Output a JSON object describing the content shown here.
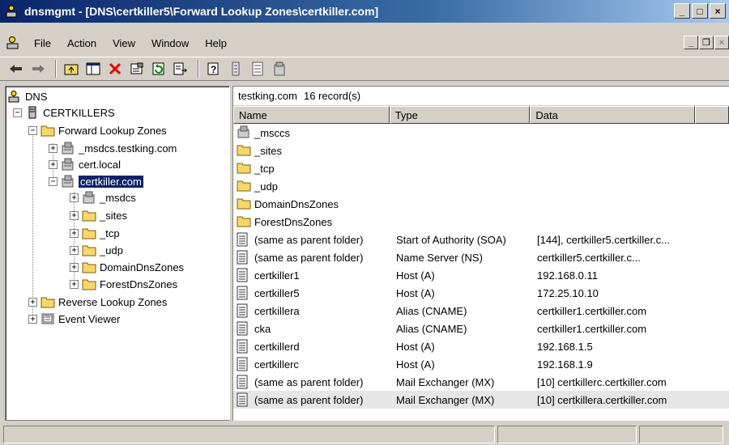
{
  "window": {
    "title": "dnsmgmt - [DNS\\certkiller5\\Forward Lookup Zones\\certkiller.com]",
    "min_label": "_",
    "max_label": "□",
    "close_label": "×"
  },
  "menu": {
    "items": [
      {
        "label": "File"
      },
      {
        "label": "Action"
      },
      {
        "label": "View"
      },
      {
        "label": "Window"
      },
      {
        "label": "Help"
      }
    ],
    "doc_min": "_",
    "doc_restore": "❐",
    "doc_close": "×"
  },
  "toolbar": {
    "icons": [
      "back-arrow-icon",
      "forward-arrow-icon",
      "up-folder-icon",
      "show-hide-tree-icon",
      "delete-icon",
      "properties-icon",
      "refresh-icon",
      "export-list-icon",
      "help-icon",
      "list-icon",
      "details-icon",
      "zone-icon"
    ]
  },
  "tree": {
    "root": "DNS",
    "server": "CERTKILLERS",
    "forward_zones": "Forward Lookup Zones",
    "zones": [
      {
        "label": "_msdcs.testking.com"
      },
      {
        "label": "cert.local"
      },
      {
        "label": "certkiller.com"
      }
    ],
    "subfolders": [
      {
        "label": "_msdcs"
      },
      {
        "label": "_sites"
      },
      {
        "label": "_tcp"
      },
      {
        "label": "_udp"
      },
      {
        "label": "DomainDnsZones"
      },
      {
        "label": "ForestDnsZones"
      }
    ],
    "reverse_zones": "Reverse Lookup Zones",
    "event_viewer": "Event Viewer"
  },
  "list": {
    "header_zone": "testking.com",
    "header_count": "16 record(s)",
    "columns": [
      "Name",
      "Type",
      "Data"
    ],
    "rows": [
      {
        "icon": "zone",
        "name": "_msccs",
        "type": "",
        "data": ""
      },
      {
        "icon": "folder",
        "name": "_sites",
        "type": "",
        "data": ""
      },
      {
        "icon": "folder",
        "name": "_tcp",
        "type": "",
        "data": ""
      },
      {
        "icon": "folder",
        "name": "_udp",
        "type": "",
        "data": ""
      },
      {
        "icon": "folder",
        "name": "DomainDnsZones",
        "type": "",
        "data": ""
      },
      {
        "icon": "folder",
        "name": "ForestDnsZones",
        "type": "",
        "data": ""
      },
      {
        "icon": "record",
        "name": "(same as parent folder)",
        "type": "Start of Authority (SOA)",
        "data": "[144], certkiller5.certkiller.c..."
      },
      {
        "icon": "record",
        "name": "(same as parent folder)",
        "type": "Name Server (NS)",
        "data": "certkiller5.certkiller.c..."
      },
      {
        "icon": "record",
        "name": "certkiller1",
        "type": "Host (A)",
        "data": "192.168.0.11"
      },
      {
        "icon": "record",
        "name": "certkiller5",
        "type": "Host (A)",
        "data": "172.25.10.10"
      },
      {
        "icon": "record",
        "name": "certkillera",
        "type": "Alias (CNAME)",
        "data": "certkiller1.certkiller.com"
      },
      {
        "icon": "record",
        "name": "cka",
        "type": "Alias (CNAME)",
        "data": "certkiller1.certkiller.com"
      },
      {
        "icon": "record",
        "name": "certkillerd",
        "type": "Host (A)",
        "data": "192.168.1.5"
      },
      {
        "icon": "record",
        "name": "certkillerc",
        "type": "Host (A)",
        "data": "192.168.1.9"
      },
      {
        "icon": "record",
        "name": "(same as parent folder)",
        "type": "Mail Exchanger (MX)",
        "data": "[10] certkillerc.certkiller.com"
      },
      {
        "icon": "record",
        "name": "(same as parent folder)",
        "type": "Mail Exchanger (MX)",
        "data": "[10]  certkillera.certkiller.com"
      }
    ]
  },
  "colors": {
    "title_start": "#0a246a",
    "title_end": "#a6caf0",
    "selection": "#0a246a",
    "folder": "#f5d76e",
    "window_bg": "#d4d0c8"
  }
}
